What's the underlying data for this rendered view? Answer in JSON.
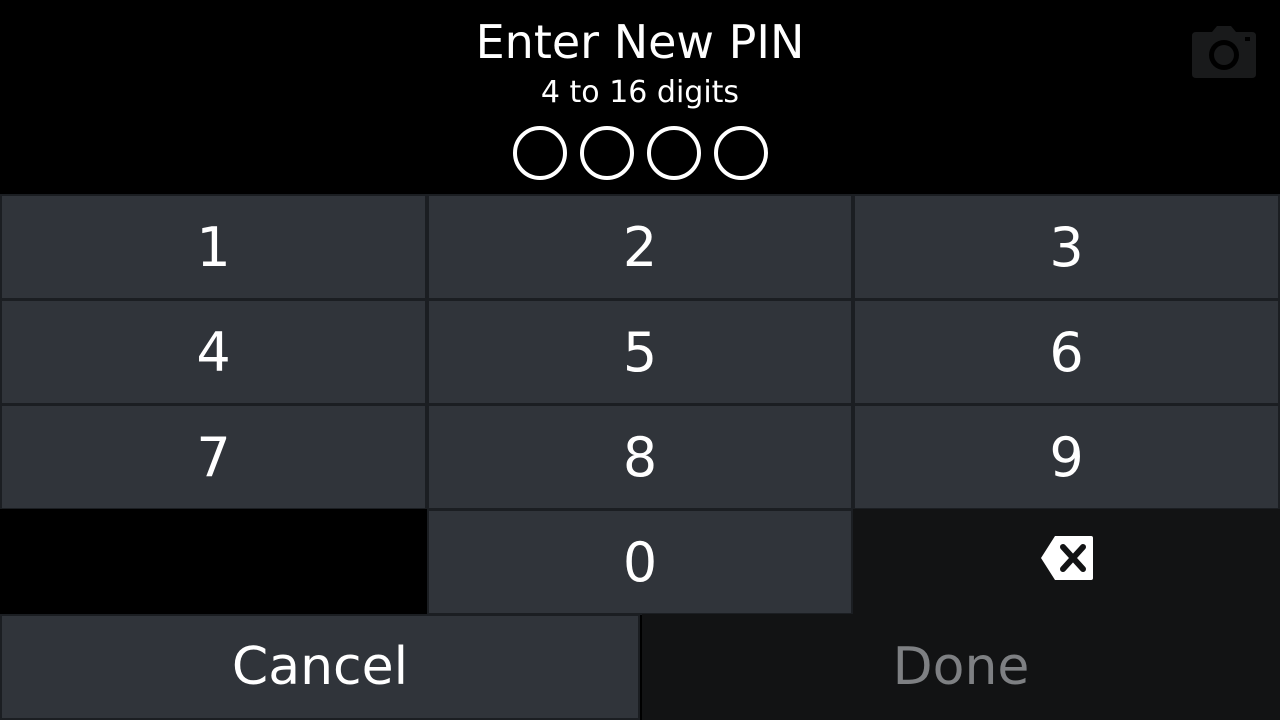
{
  "header": {
    "title": "Enter New PIN",
    "subtitle": "4 to 16 digits",
    "pin_slots": 4,
    "camera_icon": "camera-icon"
  },
  "keypad": {
    "keys": [
      "1",
      "2",
      "3",
      "4",
      "5",
      "6",
      "7",
      "8",
      "9",
      "0"
    ],
    "backspace_icon": "backspace-icon"
  },
  "actions": {
    "cancel_label": "Cancel",
    "done_label": "Done"
  },
  "colors": {
    "background": "#000000",
    "key_bg": "#30343a",
    "key_border": "#1b1e22",
    "disabled_bg": "#121314",
    "disabled_text": "#7e8083",
    "text": "#ffffff"
  }
}
